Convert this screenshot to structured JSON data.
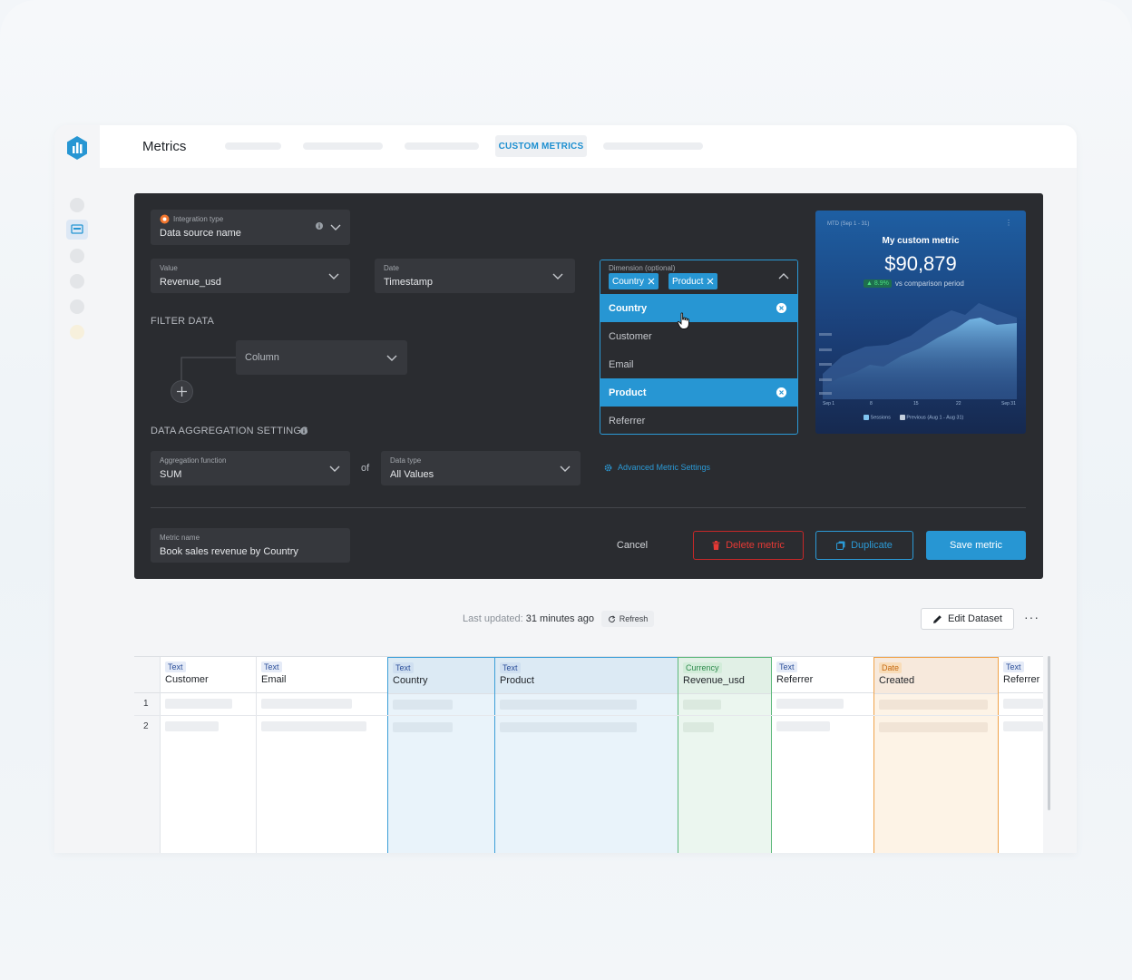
{
  "app": {
    "title": "Metrics",
    "active_tab": "CUSTOM METRICS"
  },
  "form": {
    "integration": {
      "label": "Integration type",
      "value": "Data source name"
    },
    "value_field": {
      "label": "Value",
      "value": "Revenue_usd"
    },
    "date_field": {
      "label": "Date",
      "value": "Timestamp"
    },
    "dimension": {
      "label": "Dimension (optional)",
      "chips": [
        "Country",
        "Product"
      ],
      "options": [
        {
          "label": "Country",
          "selected": true
        },
        {
          "label": "Customer",
          "selected": false
        },
        {
          "label": "Email",
          "selected": false
        },
        {
          "label": "Product",
          "selected": true
        },
        {
          "label": "Referrer",
          "selected": false
        }
      ]
    },
    "filter_heading": "FILTER DATA",
    "filter_column": "Column",
    "aggregation_heading": "DATA AGGREGATION SETTINGS",
    "aggregation": {
      "label": "Aggregation function",
      "value": "SUM"
    },
    "of_label": "of",
    "data_type": {
      "label": "Data type",
      "value": "All Values"
    },
    "advanced_link": "Advanced Metric Settings",
    "metric_name": {
      "label": "Metric name",
      "value": "Book sales revenue by Country"
    },
    "cancel": "Cancel",
    "delete": "Delete metric",
    "duplicate": "Duplicate",
    "save": "Save metric"
  },
  "preview": {
    "period": "MTD (Sep 1 - 31)",
    "title": "My custom metric",
    "value": "$90,879",
    "change": "▲ 8.9%",
    "change_label": "vs comparison period",
    "x_ticks": [
      "Sep 1",
      "8",
      "15",
      "22",
      "Sep 31"
    ],
    "legend_current": "Sessions",
    "legend_previous": "Previous (Aug 1 - Aug 31)",
    "colors": {
      "bg": "#1e5fa3",
      "accent": "#2796d3",
      "positive": "#22c55e"
    }
  },
  "status": {
    "last_updated_label": "Last updated:",
    "last_updated_value": "31 minutes ago",
    "refresh": "Refresh",
    "edit_dataset": "Edit Dataset",
    "more": "···"
  },
  "table": {
    "row_numbers": [
      "1",
      "2"
    ],
    "columns": [
      {
        "type": "Text",
        "name": "Customer"
      },
      {
        "type": "Text",
        "name": "Email"
      },
      {
        "type": "Text",
        "name": "Country"
      },
      {
        "type": "Text",
        "name": "Product"
      },
      {
        "type": "Currency",
        "name": "Revenue_usd"
      },
      {
        "type": "Text",
        "name": "Referrer"
      },
      {
        "type": "Date",
        "name": "Created"
      },
      {
        "type": "Text",
        "name": "Referrer"
      }
    ]
  }
}
